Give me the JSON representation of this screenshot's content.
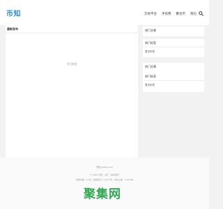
{
  "header": {
    "logo": "币知",
    "nav": [
      "交易平台",
      "手续费",
      "聚合币",
      "钱包"
    ],
    "search_icon": "search-icon"
  },
  "main": {
    "title": "最新发布",
    "empty_text": "暂无数据"
  },
  "sidebar": {
    "widgets": [
      {
        "title": "热门文章",
        "body": ""
      },
      {
        "title": "热门标签",
        "body": "暂无标签"
      },
      {
        "title": "热门文章",
        "body": ""
      },
      {
        "title": "热门标签",
        "body": "暂无标签"
      }
    ]
  },
  "footer": {
    "line1": "币知 (bizhi.com)",
    "line2": "© 2024 币知 · 关于 · 联系我们",
    "line3": "查询次数：17次 · 加载时间：0.037 秒 · 内存占用：4.55 MB"
  },
  "watermark": {
    "text": "聚集网",
    "color": "#32a852"
  },
  "colors": {
    "brand": "#2a8bd8",
    "background": "#f2f2f2"
  }
}
